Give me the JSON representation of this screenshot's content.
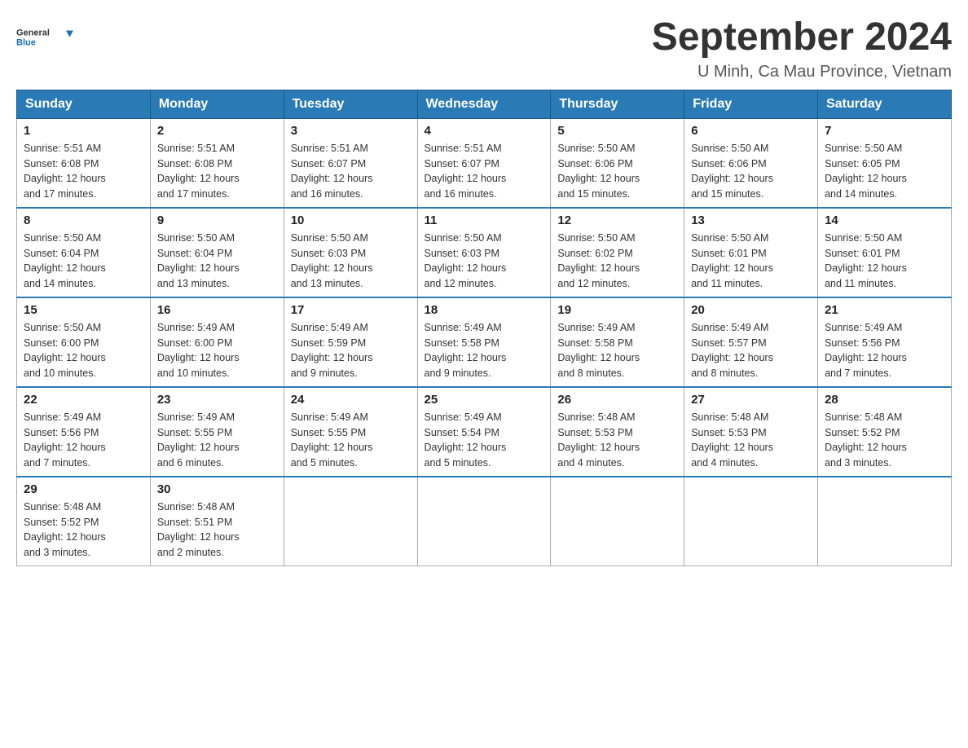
{
  "logo": {
    "general": "General",
    "blue": "Blue"
  },
  "title": "September 2024",
  "subtitle": "U Minh, Ca Mau Province, Vietnam",
  "days_of_week": [
    "Sunday",
    "Monday",
    "Tuesday",
    "Wednesday",
    "Thursday",
    "Friday",
    "Saturday"
  ],
  "weeks": [
    [
      {
        "day": "1",
        "sunrise": "5:51 AM",
        "sunset": "6:08 PM",
        "daylight": "12 hours and 17 minutes."
      },
      {
        "day": "2",
        "sunrise": "5:51 AM",
        "sunset": "6:08 PM",
        "daylight": "12 hours and 17 minutes."
      },
      {
        "day": "3",
        "sunrise": "5:51 AM",
        "sunset": "6:07 PM",
        "daylight": "12 hours and 16 minutes."
      },
      {
        "day": "4",
        "sunrise": "5:51 AM",
        "sunset": "6:07 PM",
        "daylight": "12 hours and 16 minutes."
      },
      {
        "day": "5",
        "sunrise": "5:50 AM",
        "sunset": "6:06 PM",
        "daylight": "12 hours and 15 minutes."
      },
      {
        "day": "6",
        "sunrise": "5:50 AM",
        "sunset": "6:06 PM",
        "daylight": "12 hours and 15 minutes."
      },
      {
        "day": "7",
        "sunrise": "5:50 AM",
        "sunset": "6:05 PM",
        "daylight": "12 hours and 14 minutes."
      }
    ],
    [
      {
        "day": "8",
        "sunrise": "5:50 AM",
        "sunset": "6:04 PM",
        "daylight": "12 hours and 14 minutes."
      },
      {
        "day": "9",
        "sunrise": "5:50 AM",
        "sunset": "6:04 PM",
        "daylight": "12 hours and 13 minutes."
      },
      {
        "day": "10",
        "sunrise": "5:50 AM",
        "sunset": "6:03 PM",
        "daylight": "12 hours and 13 minutes."
      },
      {
        "day": "11",
        "sunrise": "5:50 AM",
        "sunset": "6:03 PM",
        "daylight": "12 hours and 12 minutes."
      },
      {
        "day": "12",
        "sunrise": "5:50 AM",
        "sunset": "6:02 PM",
        "daylight": "12 hours and 12 minutes."
      },
      {
        "day": "13",
        "sunrise": "5:50 AM",
        "sunset": "6:01 PM",
        "daylight": "12 hours and 11 minutes."
      },
      {
        "day": "14",
        "sunrise": "5:50 AM",
        "sunset": "6:01 PM",
        "daylight": "12 hours and 11 minutes."
      }
    ],
    [
      {
        "day": "15",
        "sunrise": "5:50 AM",
        "sunset": "6:00 PM",
        "daylight": "12 hours and 10 minutes."
      },
      {
        "day": "16",
        "sunrise": "5:49 AM",
        "sunset": "6:00 PM",
        "daylight": "12 hours and 10 minutes."
      },
      {
        "day": "17",
        "sunrise": "5:49 AM",
        "sunset": "5:59 PM",
        "daylight": "12 hours and 9 minutes."
      },
      {
        "day": "18",
        "sunrise": "5:49 AM",
        "sunset": "5:58 PM",
        "daylight": "12 hours and 9 minutes."
      },
      {
        "day": "19",
        "sunrise": "5:49 AM",
        "sunset": "5:58 PM",
        "daylight": "12 hours and 8 minutes."
      },
      {
        "day": "20",
        "sunrise": "5:49 AM",
        "sunset": "5:57 PM",
        "daylight": "12 hours and 8 minutes."
      },
      {
        "day": "21",
        "sunrise": "5:49 AM",
        "sunset": "5:56 PM",
        "daylight": "12 hours and 7 minutes."
      }
    ],
    [
      {
        "day": "22",
        "sunrise": "5:49 AM",
        "sunset": "5:56 PM",
        "daylight": "12 hours and 7 minutes."
      },
      {
        "day": "23",
        "sunrise": "5:49 AM",
        "sunset": "5:55 PM",
        "daylight": "12 hours and 6 minutes."
      },
      {
        "day": "24",
        "sunrise": "5:49 AM",
        "sunset": "5:55 PM",
        "daylight": "12 hours and 5 minutes."
      },
      {
        "day": "25",
        "sunrise": "5:49 AM",
        "sunset": "5:54 PM",
        "daylight": "12 hours and 5 minutes."
      },
      {
        "day": "26",
        "sunrise": "5:48 AM",
        "sunset": "5:53 PM",
        "daylight": "12 hours and 4 minutes."
      },
      {
        "day": "27",
        "sunrise": "5:48 AM",
        "sunset": "5:53 PM",
        "daylight": "12 hours and 4 minutes."
      },
      {
        "day": "28",
        "sunrise": "5:48 AM",
        "sunset": "5:52 PM",
        "daylight": "12 hours and 3 minutes."
      }
    ],
    [
      {
        "day": "29",
        "sunrise": "5:48 AM",
        "sunset": "5:52 PM",
        "daylight": "12 hours and 3 minutes."
      },
      {
        "day": "30",
        "sunrise": "5:48 AM",
        "sunset": "5:51 PM",
        "daylight": "12 hours and 2 minutes."
      },
      null,
      null,
      null,
      null,
      null
    ]
  ]
}
